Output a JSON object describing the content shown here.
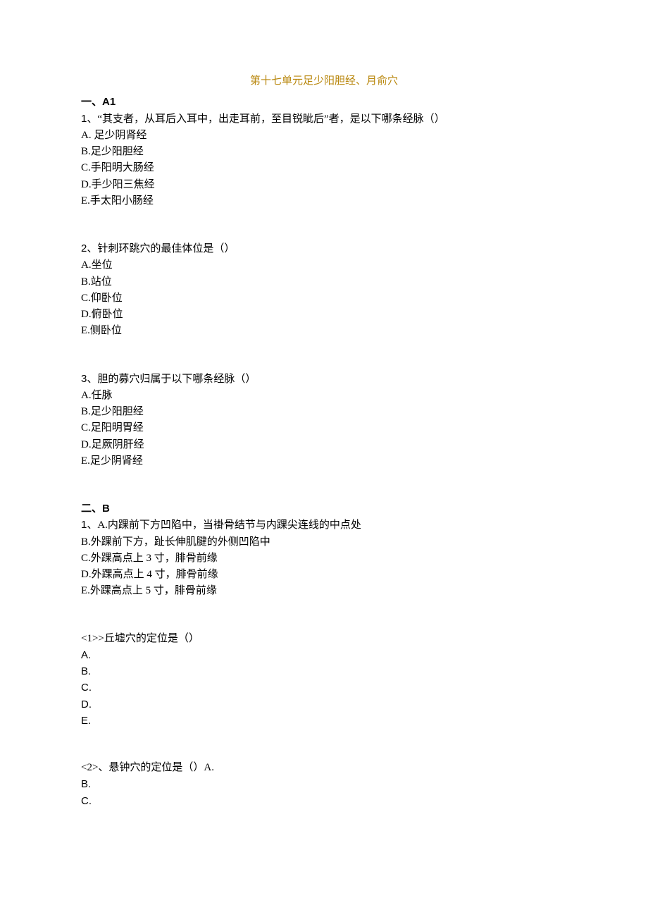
{
  "title": "第十七单元足少阳胆经、月俞穴",
  "sections": {
    "a1": {
      "heading": "一、A1",
      "questions": [
        {
          "stem_prefix": "1、",
          "stem": "“其支者，从耳后入耳中，出走耳前，至目锐眦后”者，是以下哪条经脉（）",
          "opts": {
            "A": "A. 足少阴肾经",
            "B": "B.足少阳胆经",
            "C": "C.手阳明大肠经",
            "D": "D.手少阳三焦经",
            "E": "E.手太阳小肠经"
          }
        },
        {
          "stem_prefix": "2、",
          "stem": "针刺环跳穴的最佳体位是（）",
          "opts": {
            "A": "A.坐位",
            "B": "B.站位",
            "C": "C.仰卧位",
            "D": "D.俯卧位",
            "E": "E.侧卧位"
          }
        },
        {
          "stem_prefix": "3、",
          "stem": "胆的募穴归属于以下哪条经脉（）",
          "opts": {
            "A": "A.任脉",
            "B": "B.足少阳胆经",
            "C": "C.足阳明胃经",
            "D": "D.足厥阴肝经",
            "E": "E.足少阴肾经"
          }
        }
      ]
    },
    "b": {
      "heading": "二、B",
      "shared": {
        "stem_prefix": "1、",
        "A": "A.内踝前下方凹陷中，当褂骨结节与内踝尖连线的中点处",
        "B": "B.外踝前下方，趾长伸肌腱的外侧凹陷中",
        "C": "C.外踝高点上 3 寸，腓骨前缘",
        "D": "D.外踝高点上 4 寸，腓骨前缘",
        "E": "E.外踝高点上 5 寸，腓骨前缘"
      },
      "subs": [
        {
          "stem": "<1>>丘墟穴的定位是（）",
          "opts": {
            "A": "A.",
            "B": "B.",
            "C": "C.",
            "D": "D.",
            "E": "E."
          }
        },
        {
          "stem": "<2>、悬钟穴的定位是（）A.",
          "opts": {
            "B": "B.",
            "C": "C."
          }
        }
      ]
    }
  }
}
